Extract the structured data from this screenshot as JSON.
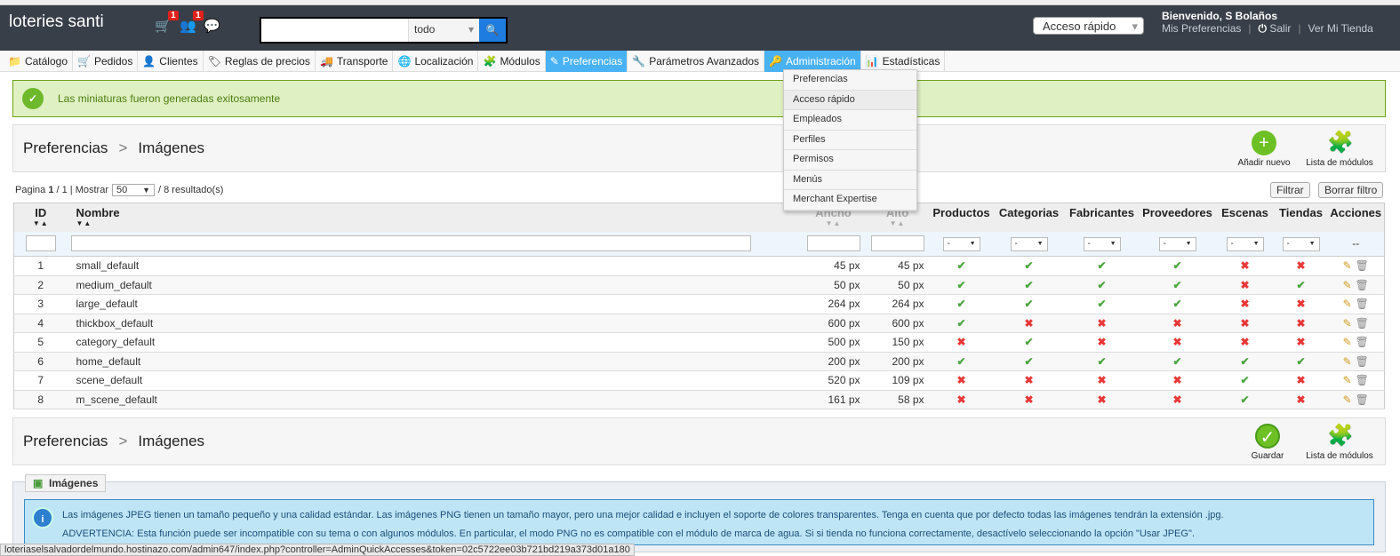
{
  "header": {
    "shop_name": "loteries santi",
    "orders_badge": "1",
    "customers_badge": "1",
    "search_scope": "todo",
    "quick_access": "Acceso rápido",
    "welcome": "Bienvenido, S Bolaños",
    "my_prefs": "Mis Preferencias",
    "logout": "Salir",
    "view_shop": "Ver Mi Tienda"
  },
  "nav": [
    {
      "label": "Catálogo",
      "icon": "📁"
    },
    {
      "label": "Pedidos",
      "icon": "🛒"
    },
    {
      "label": "Clientes",
      "icon": "👤"
    },
    {
      "label": "Reglas de precios",
      "icon": "🏷"
    },
    {
      "label": "Transporte",
      "icon": "🚚"
    },
    {
      "label": "Localización",
      "icon": "🌐"
    },
    {
      "label": "Módulos",
      "icon": "🧩"
    },
    {
      "label": "Preferencias",
      "icon": "✎",
      "active": true
    },
    {
      "label": "Parámetros Avanzados",
      "icon": "🔧"
    },
    {
      "label": "Administración",
      "icon": "🔑",
      "hover": true
    },
    {
      "label": "Estadísticas",
      "icon": "📊"
    }
  ],
  "admin_menu": [
    "Preferencias",
    "Acceso rápido",
    "Empleados",
    "Perfiles",
    "Permisos",
    "Menús",
    "Merchant Expertise"
  ],
  "success": "Las miniaturas fueron generadas exitosamente",
  "toolbar_top": {
    "crumb1": "Preferencias",
    "sep": ">",
    "crumb2": "Imágenes",
    "add_new": "Añadir nuevo",
    "module_list": "Lista de módulos"
  },
  "pager": {
    "page_label": "Pagina",
    "page": "1",
    "total_pages": "/ 1 | Mostrar",
    "per_page": "50",
    "results": "/ 8 resultado(s)",
    "filter": "Filtrar",
    "reset": "Borrar filtro"
  },
  "columns": [
    "ID",
    "Nombre",
    "Ancho",
    "Alto",
    "Productos",
    "Categorias",
    "Fabricantes",
    "Proveedores",
    "Escenas",
    "Tiendas",
    "Acciones"
  ],
  "filter_select": "-",
  "actions_filter": "--",
  "rows": [
    {
      "id": "1",
      "name": "small_default",
      "w": "45 px",
      "h": "45 px",
      "f": [
        1,
        1,
        1,
        1,
        0,
        0
      ]
    },
    {
      "id": "2",
      "name": "medium_default",
      "w": "50 px",
      "h": "50 px",
      "f": [
        1,
        1,
        1,
        1,
        0,
        1
      ]
    },
    {
      "id": "3",
      "name": "large_default",
      "w": "264 px",
      "h": "264 px",
      "f": [
        1,
        1,
        1,
        1,
        0,
        0
      ]
    },
    {
      "id": "4",
      "name": "thickbox_default",
      "w": "600 px",
      "h": "600 px",
      "f": [
        1,
        0,
        0,
        0,
        0,
        0
      ]
    },
    {
      "id": "5",
      "name": "category_default",
      "w": "500 px",
      "h": "150 px",
      "f": [
        0,
        1,
        0,
        0,
        0,
        0
      ]
    },
    {
      "id": "6",
      "name": "home_default",
      "w": "200 px",
      "h": "200 px",
      "f": [
        1,
        1,
        1,
        1,
        1,
        1
      ]
    },
    {
      "id": "7",
      "name": "scene_default",
      "w": "520 px",
      "h": "109 px",
      "f": [
        0,
        0,
        0,
        0,
        1,
        0
      ]
    },
    {
      "id": "8",
      "name": "m_scene_default",
      "w": "161 px",
      "h": "58 px",
      "f": [
        0,
        0,
        0,
        0,
        1,
        0
      ]
    }
  ],
  "toolbar_bottom": {
    "crumb1": "Preferencias",
    "sep": ">",
    "crumb2": "Imágenes",
    "save": "Guardar",
    "module_list": "Lista de módulos"
  },
  "fieldset": {
    "legend": "Imágenes",
    "info1": "Las imágenes JPEG tienen un tamaño pequeño y una calidad estándar. Las imágenes PNG tienen un tamaño mayor, pero una mejor calidad e incluyen el soporte de colores transparentes. Tenga en cuenta que por defecto todas las imágenes tendrán la extensión .jpg.",
    "info2": "ADVERTENCIA: Esta función puede ser incompatible con su tema o con algunos módulos. En particular, el modo PNG no es compatible con el módulo de marca de agua. Si si tienda no funciona correctamente, desactívelo seleccionando la opción \"Usar JPEG\"."
  },
  "status_url": "loteriaselsalvadordelmundo.hostinazo.com/admin647/index.php?controller=AdminQuickAccesses&token=02c5722ee03b721bd219a373d01a180",
  "colors": {
    "header": "#383f49",
    "active_tab": "#49b2f5",
    "success_bg": "#dff0c2",
    "info_bg": "#bee5f5",
    "yes": "#4ca640",
    "no": "#e83838"
  }
}
